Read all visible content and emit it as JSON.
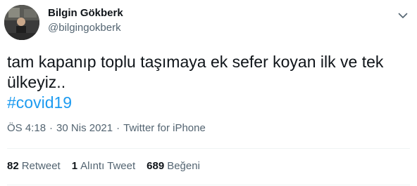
{
  "user": {
    "display_name": "Bilgin Gökberk",
    "handle": "@bilgingokberk"
  },
  "tweet": {
    "text_line1": "tam kapanıp toplu taşımaya ek sefer koyan ilk ve tek",
    "text_line2": "ülkeyiz..",
    "hashtag": "#covid19",
    "time": "ÖS 4:18",
    "date": "30 Nis 2021",
    "separator": "·",
    "source": "Twitter for iPhone"
  },
  "stats": {
    "retweets_count": "82",
    "retweets_label": "Retweet",
    "quotes_count": "1",
    "quotes_label": "Alıntı Tweet",
    "likes_count": "689",
    "likes_label": "Beğeni"
  },
  "icons": {
    "more": "chevron-down-icon"
  },
  "colors": {
    "hashtag": "#1d9bf0",
    "secondary_text": "#536471",
    "primary_text": "#0f1419"
  }
}
